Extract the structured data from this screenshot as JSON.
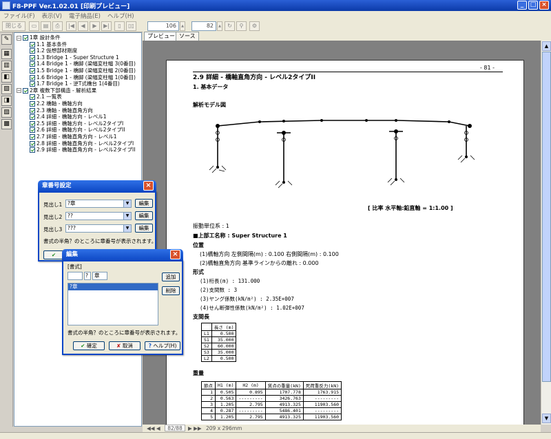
{
  "window": {
    "title": "F8-PPF Ver.1.02.01 [印刷プレビュー]"
  },
  "menu": [
    "ファイル(F)",
    "表示(V)",
    "電子納品(E)",
    "ヘルプ(H)"
  ],
  "toolbar": {
    "close_label": "閉じる",
    "page_value": "106",
    "zoom_value": "82"
  },
  "tree": {
    "items": [
      {
        "label": "1章 設計条件",
        "level": 0
      },
      {
        "label": "1.1 基本条件",
        "level": 1
      },
      {
        "label": "1.2 仮想部材剛度",
        "level": 1
      },
      {
        "label": "1.3 Bridge 1 - Super Structure 1",
        "level": 1
      },
      {
        "label": "1.4 Bridge 1 - 橋脚 (梁幅変柱幅 3(0番目)",
        "level": 1
      },
      {
        "label": "1.5 Bridge 1 - 橋脚 (梁幅変柱幅 2(0番目)",
        "level": 1
      },
      {
        "label": "1.6 Bridge 1 - 橋脚 (梁幅変柱幅 1(0番目)",
        "level": 1
      },
      {
        "label": "1.7 Bridge 1 - 逆T式橋台 1(4番目)",
        "level": 1
      },
      {
        "label": "2章 複数下部構造 - 解析結果",
        "level": 0
      },
      {
        "label": "2.1 一覧表",
        "level": 1
      },
      {
        "label": "2.2 橋軸 - 橋軸方向",
        "level": 1
      },
      {
        "label": "2.3 橋軸 - 橋軸直角方向",
        "level": 1
      },
      {
        "label": "2.4 詳細 - 橋軸方向 - レベル1",
        "level": 1
      },
      {
        "label": "2.5 詳細 - 橋軸方向 - レベル2タイプI",
        "level": 1
      },
      {
        "label": "2.6 詳細 - 橋軸方向 - レベル2タイプII",
        "level": 1
      },
      {
        "label": "2.7 詳細 - 橋軸直角方向 - レベル1",
        "level": 1
      },
      {
        "label": "2.8 詳細 - 橋軸直角方向 - レベル2タイプI",
        "level": 1
      },
      {
        "label": "2.9 詳細 - 橋軸直角方向 - レベル2タイプII",
        "level": 1
      }
    ]
  },
  "tabs": [
    "プレビュー",
    "ソース"
  ],
  "doc": {
    "page_number": "- 81 -",
    "heading": "2.9 詳細 - 橋軸直角方向 - レベル2タイプII",
    "sub1": "1. 基本データ",
    "model_label": "解析モデル図",
    "scale": "[ 比率  水平軸:鉛直軸 = 1:1.00 ]",
    "lines": [
      "振動単位系 : 1",
      "■上部工名称 : Super Structure 1",
      "位置",
      "(1)橋軸方向 左側間隔(m) : 0.100 右側間隔(m) : 0.100",
      "(2)橋軸直角方向  基準ラインからの離れ   :  0.000",
      "形式",
      "(1)桁長(m)                :      131.000",
      "(2)支間数                 :            3",
      "(3)ヤング係数(kN/m²)      :    2.35E+007",
      "(4)せん断弾性係数(kN/m²)  :    1.02E+007",
      "支間長"
    ],
    "span_table": {
      "header": [
        "",
        "長さ (m)"
      ],
      "rows": [
        [
          "L1",
          "0.500"
        ],
        [
          "S1",
          "35.000"
        ],
        [
          "S2",
          "60.000"
        ],
        [
          "S3",
          "35.000"
        ],
        [
          "L2",
          "0.500"
        ]
      ]
    },
    "weight_label": "重量",
    "weight_table": {
      "header": [
        "節点",
        "H1 (m)",
        "H2 (m)",
        "質点の重量(kN)",
        "死荷重反力(kN)"
      ],
      "rows": [
        [
          "1",
          "0.505",
          "0.895",
          "1707.778",
          "1763.915"
        ],
        [
          "2",
          "0.563",
          "---------",
          "3426.763",
          "---------"
        ],
        [
          "3",
          "1.205",
          "2.795",
          "4913.325",
          "11903.560"
        ],
        [
          "4",
          "0.287",
          "---------",
          "5486.401",
          "---------"
        ],
        [
          "5",
          "1.205",
          "2.795",
          "4913.325",
          "11903.560"
        ]
      ]
    }
  },
  "status": {
    "page": "82/88",
    "size": "209 x 296mm"
  },
  "dialog1": {
    "title": "章番号設定",
    "rows": [
      {
        "label": "見出し1",
        "value": "?章"
      },
      {
        "label": "見出し2",
        "value": "??"
      },
      {
        "label": "見出し3",
        "value": "???"
      }
    ],
    "edit_label": "編集",
    "note": "書式の半角？のところに章番号が表示されます。"
  },
  "dialog2": {
    "title": "編集",
    "group": "[書式]",
    "input_value": "",
    "q_value": "?",
    "suffix": "章",
    "list_item": "?章",
    "add": "追加",
    "delete": "削除",
    "note": "書式の半角？のところに章番号が表示されます。",
    "ok": "確定",
    "cancel": "取消",
    "help": "ヘルプ(H)"
  }
}
